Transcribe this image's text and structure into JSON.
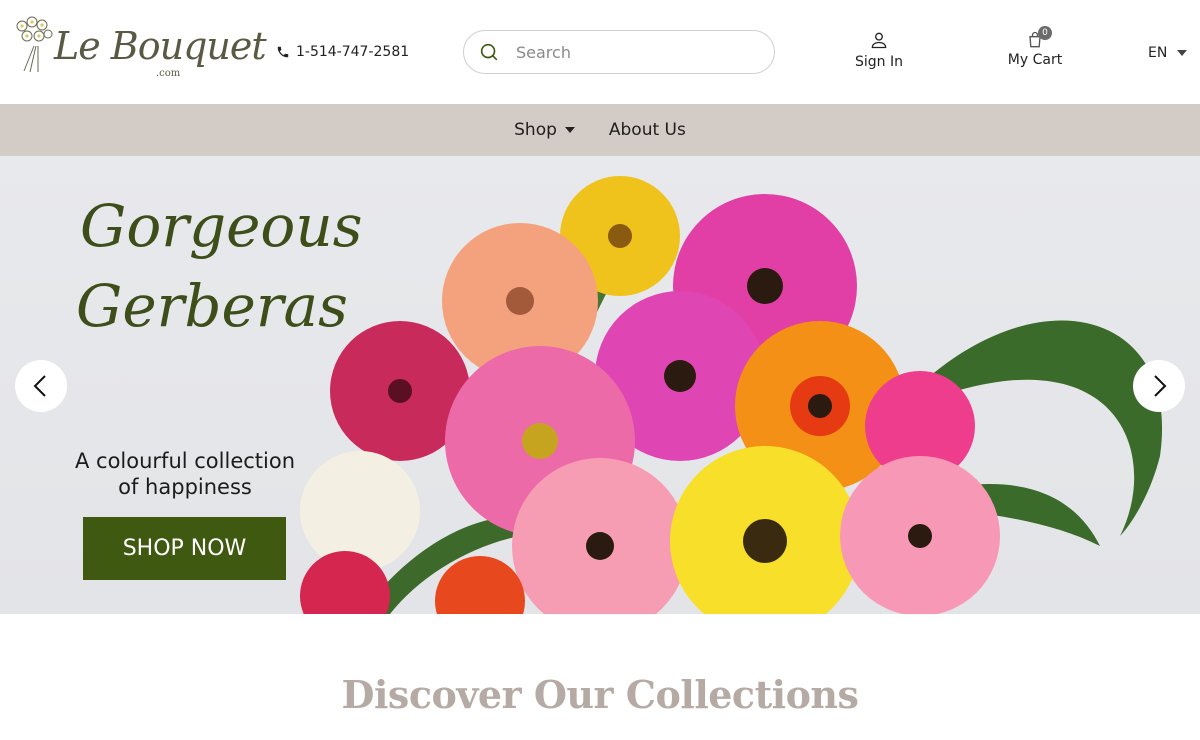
{
  "header": {
    "logo_text": "Le Bouquet",
    "logo_sub": ".com",
    "phone": "1-514-747-2581",
    "search_placeholder": "Search",
    "signin_label": "Sign In",
    "cart_label": "My Cart",
    "cart_count": "0",
    "language": "EN"
  },
  "nav": {
    "items": [
      {
        "label": "Shop",
        "has_dropdown": true
      },
      {
        "label": "About Us",
        "has_dropdown": false
      }
    ]
  },
  "hero": {
    "title_line1": "Gorgeous",
    "title_line2": "Gerberas",
    "subtitle_line1": "A colourful collection",
    "subtitle_line2": "of happiness",
    "cta_label": "SHOP NOW",
    "colors": {
      "cta_bg": "#3f5a10",
      "title": "#3e4e1a"
    }
  },
  "collections": {
    "title": "Discover Our Collections"
  },
  "icons": [
    "phone-icon",
    "search-icon",
    "user-icon",
    "cart-icon",
    "chevron-left-icon",
    "chevron-right-icon",
    "caret-down-icon"
  ]
}
